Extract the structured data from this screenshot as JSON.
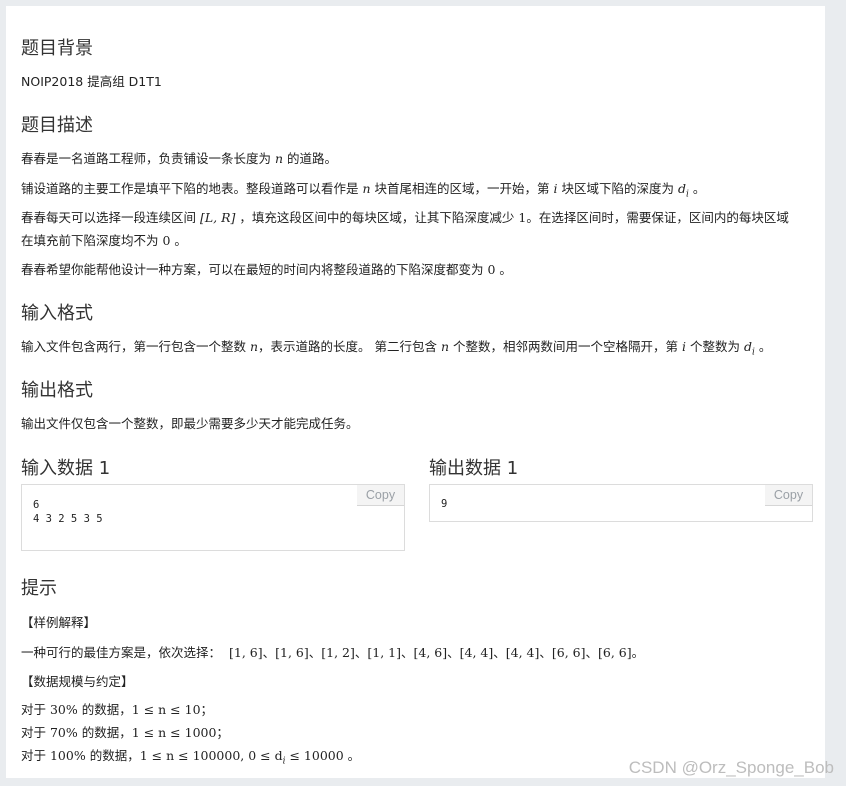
{
  "sections": {
    "background": {
      "title": "题目背景",
      "text": "NOIP2018 提高组 D1T1"
    },
    "description": {
      "title": "题目描述",
      "p1": [
        "春春是一名道路工程师，负责铺设一条长度为 ",
        "n",
        " 的道路。"
      ],
      "p2": [
        "铺设道路的主要工作是填平下陷的地表。整段道路可以看作是 ",
        "n",
        " 块首尾相连的区域，一开始，第 ",
        "i",
        " 块区域下陷的深度为 ",
        "d",
        "i",
        " 。"
      ],
      "p3a": [
        "春春每天可以选择一段连续区间 ",
        "[L, R]",
        " ，填充这段区间中的每块区域，让其下陷深度减少 ",
        "1",
        "。在选择区间时，需要保证，区间内的每块区域"
      ],
      "p3b": [
        "在填充前下陷深度均不为 ",
        "0",
        " 。"
      ],
      "p4": [
        "春春希望你能帮他设计一种方案，可以在最短的时间内将整段道路的下陷深度都变为 ",
        "0",
        " 。"
      ]
    },
    "input": {
      "title": "输入格式",
      "text": [
        "输入文件包含两行，第一行包含一个整数 ",
        "n",
        "，表示道路的长度。 第二行包含 ",
        "n",
        " 个整数，相邻两数间用一个空格隔开，第 ",
        "i",
        " 个整数为 ",
        "d",
        "i",
        " 。"
      ]
    },
    "output": {
      "title": "输出格式",
      "text": "输出文件仅包含一个整数，即最少需要多少天才能完成任务。"
    },
    "samples": {
      "input_title": "输入数据 1",
      "input_data": "6\n4 3 2 5 3 5",
      "output_title": "输出数据 1",
      "output_data": "9",
      "copy_label": "Copy"
    },
    "hint": {
      "title": "提示",
      "sample_explain_label": "【样例解释】",
      "plan_prefix": "一种可行的最佳方案是，依次选择：",
      "plan_intervals": [
        "[1, 6]",
        "[1, 6]",
        "[1, 2]",
        "[1, 1]",
        "[4, 6]",
        "[4, 4]",
        "[4, 4]",
        "[6, 6]",
        "[6, 6]"
      ],
      "plan_sep": "、",
      "plan_end": "。",
      "scale_label": "【数据规模与约定】",
      "c1": [
        "对于 ",
        "30%",
        " 的数据，",
        "1 ≤ n ≤ 10",
        "；"
      ],
      "c2": [
        "对于 ",
        "70%",
        " 的数据，",
        "1 ≤ n ≤ 1000",
        "；"
      ],
      "c3": [
        "对于 ",
        "100%",
        " 的数据，",
        "1 ≤ n ≤ 100000, 0 ≤ d",
        "i",
        " ≤ 10000",
        " 。"
      ]
    }
  },
  "watermark": "CSDN @Orz_Sponge_Bob"
}
